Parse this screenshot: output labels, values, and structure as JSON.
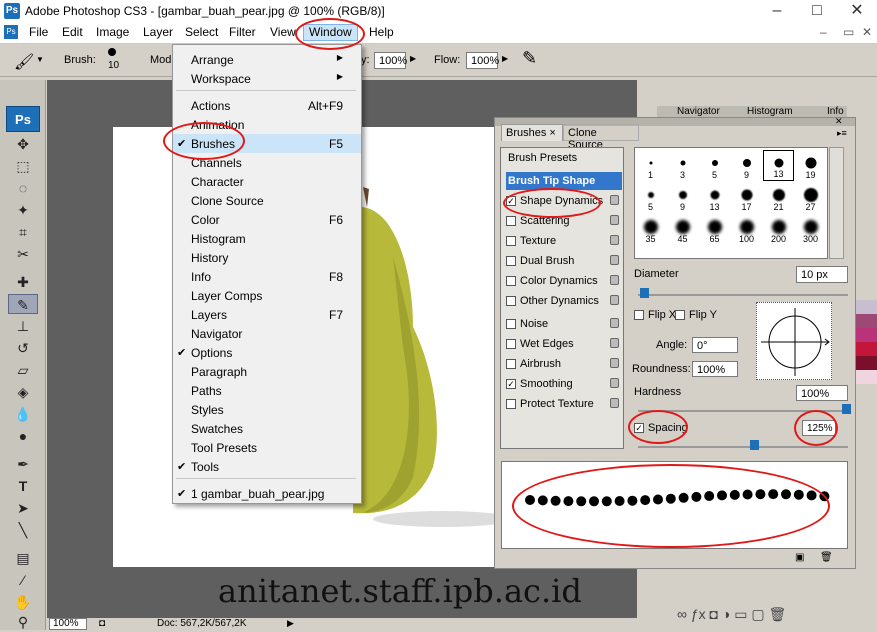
{
  "title_bar": {
    "title": "Adobe Photoshop CS3 - [gambar_buah_pear.jpg @ 100% (RGB/8)]",
    "ps_logo": "Ps",
    "minimize": "–",
    "maximize": "□",
    "close": "✕"
  },
  "menu": [
    "File",
    "Edit",
    "Image",
    "Layer",
    "Select",
    "Filter",
    "View",
    "Window",
    "Help"
  ],
  "options_bar": {
    "brush_label": "Brush:",
    "brush_size": "10",
    "mode_label": "Mod",
    "opacity_suffix": "y:",
    "opacity_value": "100%",
    "flow_label": "Flow:",
    "flow_value": "100%"
  },
  "toolbar": {
    "logo": "Ps"
  },
  "window_menu": {
    "items": [
      {
        "label": "Arrange",
        "shortcut": "",
        "submenu": true,
        "checked": false
      },
      {
        "label": "Workspace",
        "shortcut": "",
        "submenu": true,
        "checked": false
      },
      {
        "label": "Actions",
        "shortcut": "Alt+F9",
        "checked": false
      },
      {
        "label": "Animation",
        "shortcut": "",
        "checked": false
      },
      {
        "label": "Brushes",
        "shortcut": "F5",
        "checked": true
      },
      {
        "label": "Channels",
        "shortcut": "",
        "checked": false
      },
      {
        "label": "Character",
        "shortcut": "",
        "checked": false
      },
      {
        "label": "Clone Source",
        "shortcut": "",
        "checked": false
      },
      {
        "label": "Color",
        "shortcut": "F6",
        "checked": false
      },
      {
        "label": "Histogram",
        "shortcut": "",
        "checked": false
      },
      {
        "label": "History",
        "shortcut": "",
        "checked": false
      },
      {
        "label": "Info",
        "shortcut": "F8",
        "checked": false
      },
      {
        "label": "Layer Comps",
        "shortcut": "",
        "checked": false
      },
      {
        "label": "Layers",
        "shortcut": "F7",
        "checked": false
      },
      {
        "label": "Navigator",
        "shortcut": "",
        "checked": false
      },
      {
        "label": "Options",
        "shortcut": "",
        "checked": true
      },
      {
        "label": "Paragraph",
        "shortcut": "",
        "checked": false
      },
      {
        "label": "Paths",
        "shortcut": "",
        "checked": false
      },
      {
        "label": "Styles",
        "shortcut": "",
        "checked": false
      },
      {
        "label": "Swatches",
        "shortcut": "",
        "checked": false
      },
      {
        "label": "Tool Presets",
        "shortcut": "",
        "checked": false
      },
      {
        "label": "Tools",
        "shortcut": "",
        "checked": true
      },
      {
        "label": "1 gambar_buah_pear.jpg",
        "shortcut": "",
        "checked": true
      }
    ]
  },
  "brushes_panel": {
    "tabs": [
      "Brushes",
      "Clone Source"
    ],
    "brush_presets_label": "Brush Presets",
    "brush_tip_shape_label": "Brush Tip Shape",
    "options": [
      {
        "label": "Shape Dynamics",
        "checked": true
      },
      {
        "label": "Scattering",
        "checked": false
      },
      {
        "label": "Texture",
        "checked": false
      },
      {
        "label": "Dual Brush",
        "checked": false
      },
      {
        "label": "Color Dynamics",
        "checked": false
      },
      {
        "label": "Other Dynamics",
        "checked": false
      },
      {
        "label": "Noise",
        "checked": false
      },
      {
        "label": "Wet Edges",
        "checked": false
      },
      {
        "label": "Airbrush",
        "checked": false
      },
      {
        "label": "Smoothing",
        "checked": true
      },
      {
        "label": "Protect Texture",
        "checked": false
      }
    ],
    "tip_sizes": [
      "1",
      "3",
      "5",
      "9",
      "13",
      "19",
      "5",
      "9",
      "13",
      "17",
      "21",
      "27",
      "35",
      "45",
      "65",
      "100",
      "200",
      "300"
    ],
    "diameter_label": "Diameter",
    "diameter_value": "10 px",
    "flip_x_label": "Flip X",
    "flip_y_label": "Flip Y",
    "angle_label": "Angle:",
    "angle_value": "0°",
    "roundness_label": "Roundness:",
    "roundness_value": "100%",
    "hardness_label": "Hardness",
    "hardness_value": "100%",
    "spacing_label": "Spacing",
    "spacing_value": "125%"
  },
  "right_panel": {
    "tabs": [
      "Navigator",
      "Histogram",
      "Info"
    ]
  },
  "status_bar": {
    "zoom": "100%",
    "doc": "Doc: 567,2K/567,2K"
  },
  "watermark": "anitanet.staff.ipb.ac.id",
  "colors": {
    "annotation_red": "#e01818",
    "menu_highlight": "#cce4f7",
    "pear_green": "#b7b93a"
  }
}
